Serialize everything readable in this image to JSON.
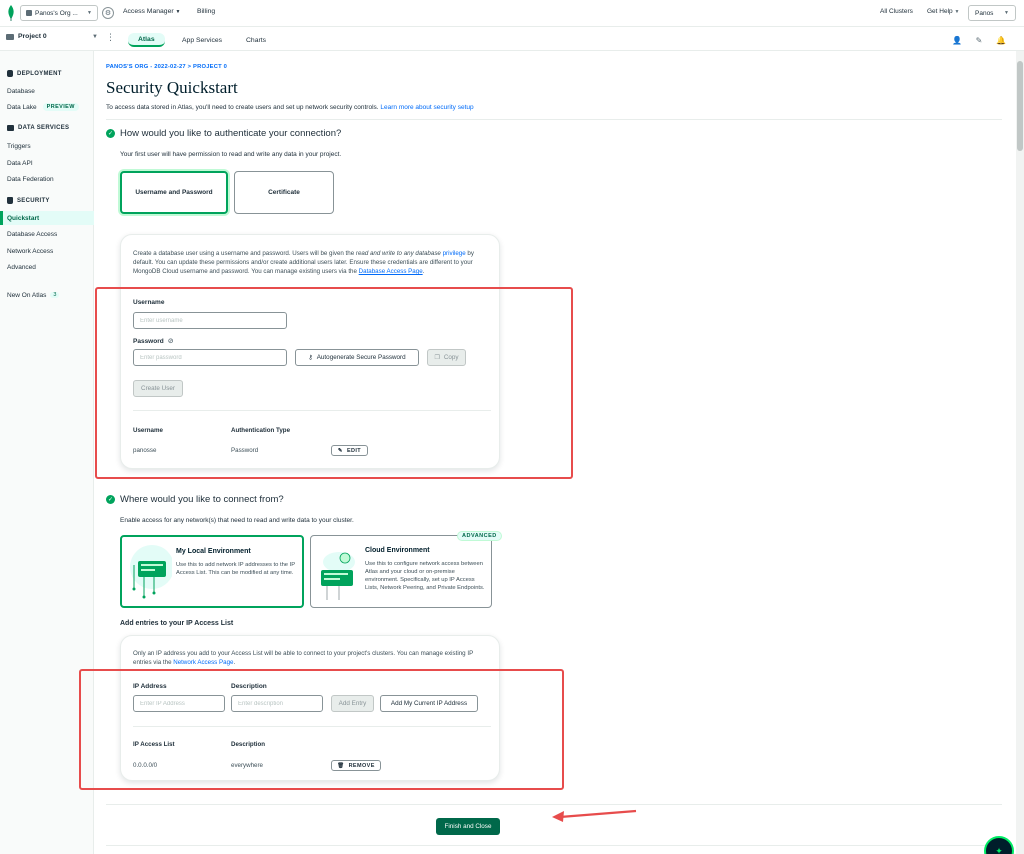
{
  "topbar": {
    "org_name": "Panos's Org ...",
    "access_manager": "Access Manager",
    "billing": "Billing",
    "all_clusters": "All Clusters",
    "get_help": "Get Help",
    "user": "Panos"
  },
  "subbar": {
    "project": "Project 0",
    "tabs": [
      "Atlas",
      "App Services",
      "Charts"
    ]
  },
  "sidebar": {
    "deployment": "DEPLOYMENT",
    "database": "Database",
    "data_lake": "Data Lake",
    "preview_badge": "PREVIEW",
    "data_services": "DATA SERVICES",
    "triggers": "Triggers",
    "data_api": "Data API",
    "data_federation": "Data Federation",
    "security": "SECURITY",
    "quickstart": "Quickstart",
    "database_access": "Database Access",
    "network_access": "Network Access",
    "advanced": "Advanced",
    "new_on_atlas": "New On Atlas",
    "new_count": "3"
  },
  "main": {
    "breadcrumb": "PANOS'S ORG - 2022-02-27 > PROJECT 0",
    "title": "Security Quickstart",
    "intro": "To access data stored in Atlas, you'll need to create users and set up network security controls.",
    "intro_link": "Learn more about security setup"
  },
  "auth": {
    "heading": "How would you like to authenticate your connection?",
    "sub": "Your first user will have permission to read and write any data in your project.",
    "option_userpass": "Username and Password",
    "option_cert": "Certificate",
    "desc_1": "Create a database user using a username and password. Users will be given the",
    "desc_em": "read and write to any database",
    "desc_link_privilege": "privilege",
    "desc_2": "by default. You can update these permissions and/or create additional users later. Ensure these credentials are different to your MongoDB Cloud username and password. You can manage existing users via the",
    "desc_link_dbaccess": "Database Access Page",
    "desc_end": ".",
    "username_label": "Username",
    "username_placeholder": "Enter username",
    "password_label": "Password",
    "password_placeholder": "Enter password",
    "autogen_button": "Autogenerate Secure Password",
    "copy_button": "Copy",
    "create_user_button": "Create User",
    "col_username": "Username",
    "col_auth_type": "Authentication Type",
    "row_username": "panosse",
    "row_auth_type": "Password",
    "edit_button": "EDIT"
  },
  "connect": {
    "heading": "Where would you like to connect from?",
    "sub": "Enable access for any network(s) that need to read and write data to your cluster.",
    "local_title": "My Local Environment",
    "local_desc": "Use this to add network IP addresses to the IP Access List. This can be modified at any time.",
    "cloud_title": "Cloud Environment",
    "cloud_desc": "Use this to configure network access between Atlas and your cloud or on-premise environment. Specifically, set up IP Access Lists, Network Peering, and Private Endpoints.",
    "advanced_badge": "ADVANCED"
  },
  "ip": {
    "heading": "Add entries to your IP Access List",
    "desc_1": "Only an IP address you add to your Access List will be able to connect to your project's clusters. You can manage existing IP entries via the",
    "desc_link": "Network Access Page",
    "desc_end": ".",
    "ip_label": "IP Address",
    "ip_placeholder": "Enter IP Address",
    "desc_label": "Description",
    "desc_placeholder": "Enter description",
    "add_entry_button": "Add Entry",
    "add_current_button": "Add My Current IP Address",
    "col_ip": "IP Access List",
    "col_desc": "Description",
    "row_ip": "0.0.0.0/0",
    "row_desc": "everywhere",
    "remove_button": "REMOVE"
  },
  "footer": {
    "finish_button": "Finish and Close"
  },
  "colors": {
    "brand_green": "#00a35c",
    "dark_green": "#00684a",
    "link_blue": "#016bf8",
    "annotation_red": "#e74c4c"
  },
  "icons": [
    "mongodb-leaf-icon",
    "gear-icon",
    "folder-icon",
    "kebab-icon",
    "user-add-icon",
    "user-settings-icon",
    "bell-icon",
    "database-icon",
    "data-services-icon",
    "lock-icon",
    "check-icon",
    "eye-off-icon",
    "key-icon",
    "copy-icon",
    "pencil-icon",
    "trash-icon",
    "arrow-icon"
  ]
}
